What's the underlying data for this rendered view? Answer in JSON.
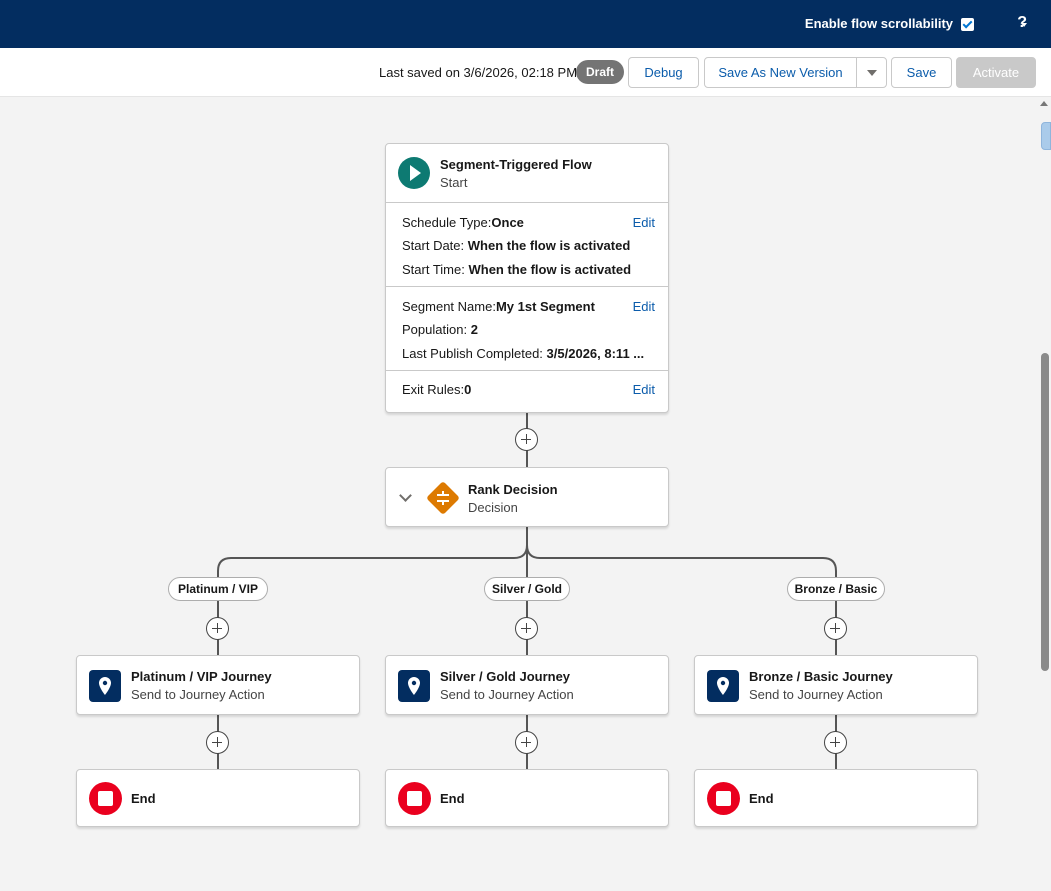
{
  "header": {
    "scroll_label": "Enable flow scrollability",
    "scroll_checked": true,
    "help": "?"
  },
  "toolbar": {
    "saved_text": "Last saved on 3/6/2026, 02:18 PM",
    "status_badge": "Draft",
    "debug": "Debug",
    "save_new_version": "Save As New Version",
    "save": "Save",
    "activate": "Activate"
  },
  "start": {
    "title": "Segment-Triggered Flow",
    "subtitle": "Start",
    "schedule": {
      "type_label": "Schedule Type:",
      "type_value": "Once",
      "start_date_label": "Start Date:",
      "start_date_value": "When the flow is activated",
      "start_time_label": "Start Time:",
      "start_time_value": "When the flow is activated",
      "edit": "Edit"
    },
    "segment": {
      "name_label": "Segment Name:",
      "name_value": "My 1st Segment",
      "population_label": "Population:",
      "population_value": "2",
      "publish_label": "Last Publish Completed:",
      "publish_value": "3/5/2026, 8:11 ...",
      "edit": "Edit"
    },
    "exit": {
      "label": "Exit Rules:",
      "value": "0",
      "edit": "Edit"
    }
  },
  "decision": {
    "title": "Rank Decision",
    "subtitle": "Decision"
  },
  "branches": [
    {
      "label": "Platinum / VIP",
      "action_title": "Platinum / VIP Journey",
      "action_sub": "Send to Journey Action",
      "end": "End"
    },
    {
      "label": "Silver / Gold",
      "action_title": "Silver / Gold Journey",
      "action_sub": "Send to Journey Action",
      "end": "End"
    },
    {
      "label": "Bronze / Basic",
      "action_title": "Bronze / Basic Journey",
      "action_sub": "Send to Journey Action",
      "end": "End"
    }
  ],
  "colors": {
    "header": "#032d60",
    "start_icon": "#0d7a72",
    "decision_icon": "#dd7a01",
    "action_icon": "#032d60",
    "end_icon": "#ea001e",
    "link": "#0b5cab"
  },
  "icons": {
    "start": "play-icon",
    "decision": "decision-diamond-icon",
    "action": "location-pin-icon",
    "end": "stop-icon",
    "add": "plus-circle-icon"
  }
}
